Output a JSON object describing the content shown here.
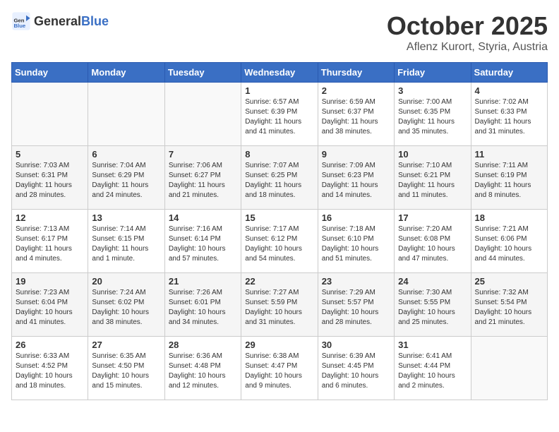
{
  "header": {
    "logo_general": "General",
    "logo_blue": "Blue",
    "month": "October 2025",
    "location": "Aflenz Kurort, Styria, Austria"
  },
  "days_of_week": [
    "Sunday",
    "Monday",
    "Tuesday",
    "Wednesday",
    "Thursday",
    "Friday",
    "Saturday"
  ],
  "weeks": [
    [
      {
        "day": "",
        "info": ""
      },
      {
        "day": "",
        "info": ""
      },
      {
        "day": "",
        "info": ""
      },
      {
        "day": "1",
        "info": "Sunrise: 6:57 AM\nSunset: 6:39 PM\nDaylight: 11 hours\nand 41 minutes."
      },
      {
        "day": "2",
        "info": "Sunrise: 6:59 AM\nSunset: 6:37 PM\nDaylight: 11 hours\nand 38 minutes."
      },
      {
        "day": "3",
        "info": "Sunrise: 7:00 AM\nSunset: 6:35 PM\nDaylight: 11 hours\nand 35 minutes."
      },
      {
        "day": "4",
        "info": "Sunrise: 7:02 AM\nSunset: 6:33 PM\nDaylight: 11 hours\nand 31 minutes."
      }
    ],
    [
      {
        "day": "5",
        "info": "Sunrise: 7:03 AM\nSunset: 6:31 PM\nDaylight: 11 hours\nand 28 minutes."
      },
      {
        "day": "6",
        "info": "Sunrise: 7:04 AM\nSunset: 6:29 PM\nDaylight: 11 hours\nand 24 minutes."
      },
      {
        "day": "7",
        "info": "Sunrise: 7:06 AM\nSunset: 6:27 PM\nDaylight: 11 hours\nand 21 minutes."
      },
      {
        "day": "8",
        "info": "Sunrise: 7:07 AM\nSunset: 6:25 PM\nDaylight: 11 hours\nand 18 minutes."
      },
      {
        "day": "9",
        "info": "Sunrise: 7:09 AM\nSunset: 6:23 PM\nDaylight: 11 hours\nand 14 minutes."
      },
      {
        "day": "10",
        "info": "Sunrise: 7:10 AM\nSunset: 6:21 PM\nDaylight: 11 hours\nand 11 minutes."
      },
      {
        "day": "11",
        "info": "Sunrise: 7:11 AM\nSunset: 6:19 PM\nDaylight: 11 hours\nand 8 minutes."
      }
    ],
    [
      {
        "day": "12",
        "info": "Sunrise: 7:13 AM\nSunset: 6:17 PM\nDaylight: 11 hours\nand 4 minutes."
      },
      {
        "day": "13",
        "info": "Sunrise: 7:14 AM\nSunset: 6:15 PM\nDaylight: 11 hours\nand 1 minute."
      },
      {
        "day": "14",
        "info": "Sunrise: 7:16 AM\nSunset: 6:14 PM\nDaylight: 10 hours\nand 57 minutes."
      },
      {
        "day": "15",
        "info": "Sunrise: 7:17 AM\nSunset: 6:12 PM\nDaylight: 10 hours\nand 54 minutes."
      },
      {
        "day": "16",
        "info": "Sunrise: 7:18 AM\nSunset: 6:10 PM\nDaylight: 10 hours\nand 51 minutes."
      },
      {
        "day": "17",
        "info": "Sunrise: 7:20 AM\nSunset: 6:08 PM\nDaylight: 10 hours\nand 47 minutes."
      },
      {
        "day": "18",
        "info": "Sunrise: 7:21 AM\nSunset: 6:06 PM\nDaylight: 10 hours\nand 44 minutes."
      }
    ],
    [
      {
        "day": "19",
        "info": "Sunrise: 7:23 AM\nSunset: 6:04 PM\nDaylight: 10 hours\nand 41 minutes."
      },
      {
        "day": "20",
        "info": "Sunrise: 7:24 AM\nSunset: 6:02 PM\nDaylight: 10 hours\nand 38 minutes."
      },
      {
        "day": "21",
        "info": "Sunrise: 7:26 AM\nSunset: 6:01 PM\nDaylight: 10 hours\nand 34 minutes."
      },
      {
        "day": "22",
        "info": "Sunrise: 7:27 AM\nSunset: 5:59 PM\nDaylight: 10 hours\nand 31 minutes."
      },
      {
        "day": "23",
        "info": "Sunrise: 7:29 AM\nSunset: 5:57 PM\nDaylight: 10 hours\nand 28 minutes."
      },
      {
        "day": "24",
        "info": "Sunrise: 7:30 AM\nSunset: 5:55 PM\nDaylight: 10 hours\nand 25 minutes."
      },
      {
        "day": "25",
        "info": "Sunrise: 7:32 AM\nSunset: 5:54 PM\nDaylight: 10 hours\nand 21 minutes."
      }
    ],
    [
      {
        "day": "26",
        "info": "Sunrise: 6:33 AM\nSunset: 4:52 PM\nDaylight: 10 hours\nand 18 minutes."
      },
      {
        "day": "27",
        "info": "Sunrise: 6:35 AM\nSunset: 4:50 PM\nDaylight: 10 hours\nand 15 minutes."
      },
      {
        "day": "28",
        "info": "Sunrise: 6:36 AM\nSunset: 4:48 PM\nDaylight: 10 hours\nand 12 minutes."
      },
      {
        "day": "29",
        "info": "Sunrise: 6:38 AM\nSunset: 4:47 PM\nDaylight: 10 hours\nand 9 minutes."
      },
      {
        "day": "30",
        "info": "Sunrise: 6:39 AM\nSunset: 4:45 PM\nDaylight: 10 hours\nand 6 minutes."
      },
      {
        "day": "31",
        "info": "Sunrise: 6:41 AM\nSunset: 4:44 PM\nDaylight: 10 hours\nand 2 minutes."
      },
      {
        "day": "",
        "info": ""
      }
    ]
  ]
}
